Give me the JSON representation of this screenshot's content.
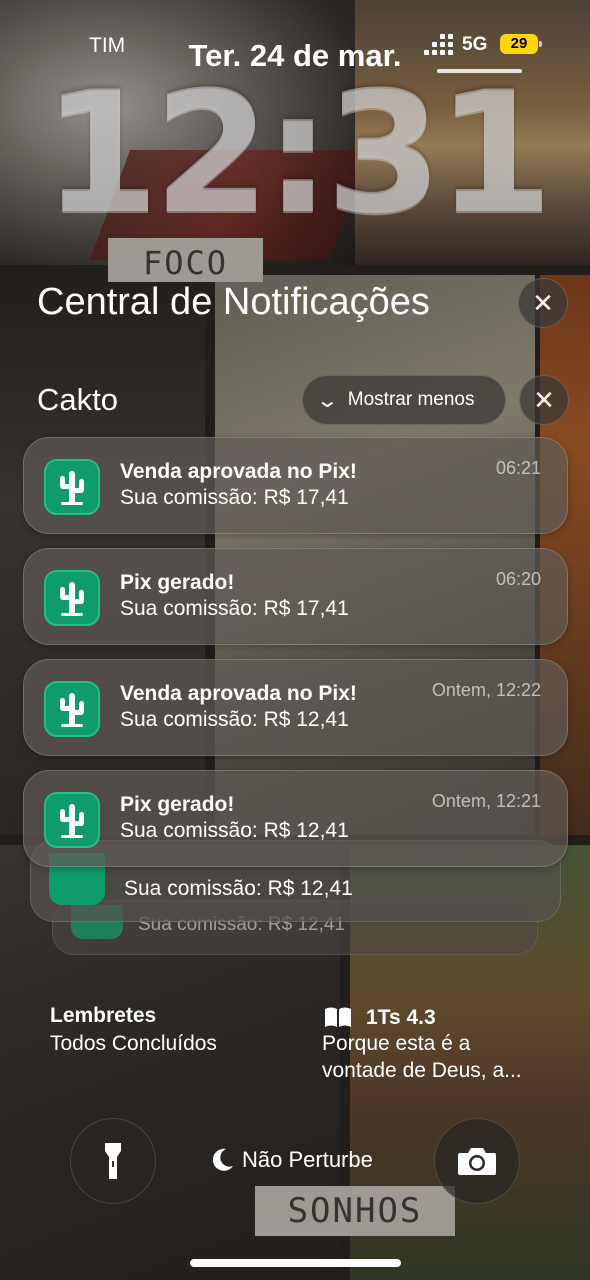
{
  "status_bar": {
    "carrier": "TIM",
    "network": "5G",
    "battery": "29",
    "battery_color": "#ffd60a"
  },
  "lock_screen": {
    "date": "Ter. 24 de mar.",
    "time": "12:31"
  },
  "wallpaper_words": [
    "FOCO",
    "SONHOS"
  ],
  "notification_center": {
    "title": "Central de Notificações",
    "close_icon": "close-icon"
  },
  "group": {
    "app_name": "Cakto",
    "show_less_label": "Mostrar menos",
    "app_icon": "cactus-icon",
    "app_icon_color": "#0f9b6c"
  },
  "notifications": [
    {
      "title": "Venda aprovada no Pix!",
      "body": "Sua comissão: R$ 17,41",
      "time": "06:21"
    },
    {
      "title": "Pix gerado!",
      "body": "Sua comissão: R$ 17,41",
      "time": "06:20"
    },
    {
      "title": "Venda aprovada no Pix!",
      "body": "Sua comissão: R$ 12,41",
      "time": "Ontem, 12:22"
    },
    {
      "title": "Pix gerado!",
      "body": "Sua comissão: R$ 12,41",
      "time": "Ontem, 12:21"
    }
  ],
  "stacked_notifications": [
    {
      "body": "Sua comissão: R$ 12,41"
    },
    {
      "body": "Sua comissão: R$ 12,41"
    }
  ],
  "widgets": {
    "reminders": {
      "title": "Lembretes",
      "text": "Todos Concluídos"
    },
    "bible": {
      "icon": "book-icon",
      "title": "1Ts 4.3",
      "line1": "Porque esta é a",
      "line2": "vontade de Deus, a..."
    }
  },
  "bottom": {
    "flashlight_icon": "flashlight-icon",
    "focus_label": "Não Perturbe",
    "focus_icon": "moon-icon",
    "camera_icon": "camera-icon"
  }
}
